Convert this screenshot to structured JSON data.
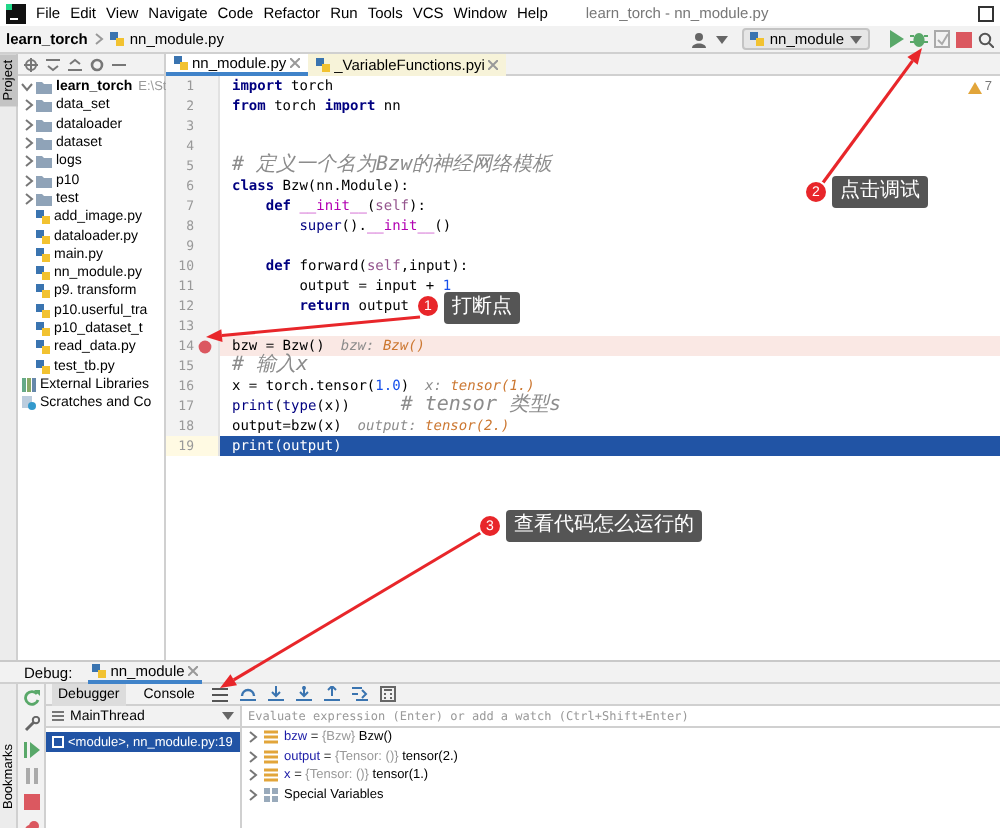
{
  "menu": [
    "File",
    "Edit",
    "View",
    "Navigate",
    "Code",
    "Refactor",
    "Run",
    "Tools",
    "VCS",
    "Window",
    "Help"
  ],
  "window": {
    "title": "learn_torch - nn_module.py"
  },
  "breadcrumb": [
    "learn_torch",
    "nn_module.py"
  ],
  "run_config": {
    "label": "nn_module"
  },
  "left_strip": {
    "top": [
      {
        "label": "Project",
        "selected": true
      }
    ],
    "bottom": [
      {
        "label": "Bookmarks",
        "selected": false
      }
    ]
  },
  "project": {
    "tree": [
      {
        "label": "learn_torch",
        "path": "E:\\St",
        "kind": "folder",
        "expanded": true,
        "children": [
          {
            "label": "data_set",
            "kind": "folder",
            "expanded": false
          },
          {
            "label": "dataloader",
            "kind": "folder",
            "expanded": false
          },
          {
            "label": "dataset",
            "kind": "folder",
            "expanded": false
          },
          {
            "label": "logs",
            "kind": "folder",
            "expanded": false
          },
          {
            "label": "p10",
            "kind": "folder",
            "expanded": false
          },
          {
            "label": "test",
            "kind": "folder",
            "expanded": false
          },
          {
            "label": "add_image.py",
            "kind": "file"
          },
          {
            "label": "dataloader.py",
            "kind": "file"
          },
          {
            "label": "main.py",
            "kind": "file"
          },
          {
            "label": "nn_module.py",
            "kind": "file"
          },
          {
            "label": "p9. transform",
            "kind": "file"
          },
          {
            "label": "p10.userful_tra",
            "kind": "file"
          },
          {
            "label": "p10_dataset_t",
            "kind": "file"
          },
          {
            "label": "read_data.py",
            "kind": "file"
          },
          {
            "label": "test_tb.py",
            "kind": "file"
          }
        ]
      },
      {
        "label": "External Libraries",
        "kind": "library"
      },
      {
        "label": "Scratches and Co",
        "kind": "scratches"
      }
    ]
  },
  "editor_tabs": [
    {
      "label": "nn_module.py",
      "selected": true
    },
    {
      "label": "_VariableFunctions.pyi",
      "selected": false
    }
  ],
  "warnings": "7",
  "code_lines": [
    {
      "number": "1",
      "breakpoint": false,
      "selected": false,
      "segments": [
        {
          "text": "import",
          "kind": "kw"
        },
        {
          "text": " torch",
          "kind": "plain"
        }
      ]
    },
    {
      "number": "2",
      "breakpoint": false,
      "selected": false,
      "segments": [
        {
          "text": "from",
          "kind": "kw"
        },
        {
          "text": " torch ",
          "kind": "plain"
        },
        {
          "text": "import",
          "kind": "kw"
        },
        {
          "text": " nn",
          "kind": "plain"
        }
      ]
    },
    {
      "number": "3",
      "breakpoint": false,
      "selected": false
    },
    {
      "number": "4",
      "breakpoint": false,
      "selected": false
    },
    {
      "number": "5",
      "breakpoint": false,
      "selected": false,
      "segments": [
        {
          "text": "# 定义一个名为Bzw的神经网络模板",
          "kind": "cm"
        }
      ]
    },
    {
      "number": "6",
      "breakpoint": false,
      "selected": false,
      "segments": [
        {
          "text": "class",
          "kind": "kw"
        },
        {
          "text": " Bzw(nn.Module):",
          "kind": "plain"
        }
      ]
    },
    {
      "number": "7",
      "breakpoint": false,
      "selected": false,
      "segments": [
        {
          "text": "    def ",
          "kind": "kw"
        },
        {
          "text": "__init__",
          "kind": "dunder"
        },
        {
          "text": "(",
          "kind": "plain"
        },
        {
          "text": "self",
          "kind": "self"
        },
        {
          "text": "):",
          "kind": "plain"
        }
      ]
    },
    {
      "number": "8",
      "breakpoint": false,
      "selected": false,
      "segments": [
        {
          "text": "        super",
          "kind": "builtin"
        },
        {
          "text": "().",
          "kind": "plain"
        },
        {
          "text": "__init__",
          "kind": "dunder"
        },
        {
          "text": "()",
          "kind": "plain"
        }
      ]
    },
    {
      "number": "9",
      "breakpoint": false,
      "selected": false
    },
    {
      "number": "10",
      "breakpoint": false,
      "selected": false,
      "segments": [
        {
          "text": "    def",
          "kind": "kw"
        },
        {
          "text": " forward(",
          "kind": "plain"
        },
        {
          "text": "self",
          "kind": "self"
        },
        {
          "text": ",input):",
          "kind": "plain"
        }
      ]
    },
    {
      "number": "11",
      "breakpoint": false,
      "selected": false,
      "segments": [
        {
          "text": "        output = input + ",
          "kind": "plain"
        },
        {
          "text": "1",
          "kind": "num"
        }
      ]
    },
    {
      "number": "12",
      "breakpoint": false,
      "selected": false,
      "segments": [
        {
          "text": "        return",
          "kind": "kw"
        },
        {
          "text": " output",
          "kind": "plain"
        }
      ]
    },
    {
      "number": "13",
      "breakpoint": false,
      "selected": false
    },
    {
      "number": "14",
      "breakpoint": true,
      "selected": false,
      "segments": [
        {
          "text": "bzw = Bzw()",
          "kind": "plain"
        }
      ],
      "hint": {
        "label": "bzw:",
        "value": "Bzw()"
      }
    },
    {
      "number": "15",
      "breakpoint": false,
      "selected": false,
      "segments": [
        {
          "text": "# 输入x",
          "kind": "cm"
        }
      ]
    },
    {
      "number": "16",
      "breakpoint": false,
      "selected": false,
      "segments": [
        {
          "text": "x = torch.tensor(",
          "kind": "plain"
        },
        {
          "text": "1.0",
          "kind": "num"
        },
        {
          "text": ")",
          "kind": "plain"
        }
      ],
      "hint": {
        "label": "x:",
        "value": "tensor(1.)"
      }
    },
    {
      "number": "17",
      "breakpoint": false,
      "selected": false,
      "segments": [
        {
          "text": "print",
          "kind": "builtin"
        },
        {
          "text": "(",
          "kind": "plain"
        },
        {
          "text": "type",
          "kind": "builtin"
        },
        {
          "text": "(x))      ",
          "kind": "plain"
        },
        {
          "text": "# tensor 类型s",
          "kind": "cm"
        }
      ]
    },
    {
      "number": "18",
      "breakpoint": false,
      "selected": false,
      "segments": [
        {
          "text": "output=bzw(x)",
          "kind": "plain"
        }
      ],
      "hint": {
        "label": "output:",
        "value": "tensor(2.)"
      }
    },
    {
      "number": "19",
      "breakpoint": false,
      "selected": true,
      "segments": [
        {
          "text": "print(output)",
          "kind": "plain"
        }
      ]
    }
  ],
  "debug": {
    "label": "Debug:",
    "session": {
      "label": "nn_module",
      "selected": true
    },
    "tabs": [
      {
        "label": "Debugger",
        "selected": true
      },
      {
        "label": "Console",
        "selected": false
      }
    ],
    "thread": "MainThread",
    "frames": [
      {
        "label": "<module>, nn_module.py:19",
        "selected": true
      }
    ],
    "evaluate_placeholder": "Evaluate expression (Enter) or add a watch (Ctrl+Shift+Enter)",
    "variables": [
      {
        "kind": "var",
        "name": "bzw",
        "sep": "=",
        "type": "{Bzw}",
        "value": "Bzw()",
        "expanded": false
      },
      {
        "kind": "var",
        "name": "output",
        "sep": "=",
        "type": "{Tensor: ()}",
        "value": "tensor(2.)",
        "expanded": false
      },
      {
        "kind": "var",
        "name": "x",
        "sep": "=",
        "type": "{Tensor: ()}",
        "value": "tensor(1.)",
        "expanded": false
      },
      {
        "kind": "special",
        "name": "Special Variables",
        "expanded": false
      }
    ]
  },
  "annotations": [
    {
      "number": "1",
      "text": "打断点"
    },
    {
      "number": "2",
      "text": "点击调试"
    },
    {
      "number": "3",
      "text": "查看代码怎么运行的"
    }
  ]
}
